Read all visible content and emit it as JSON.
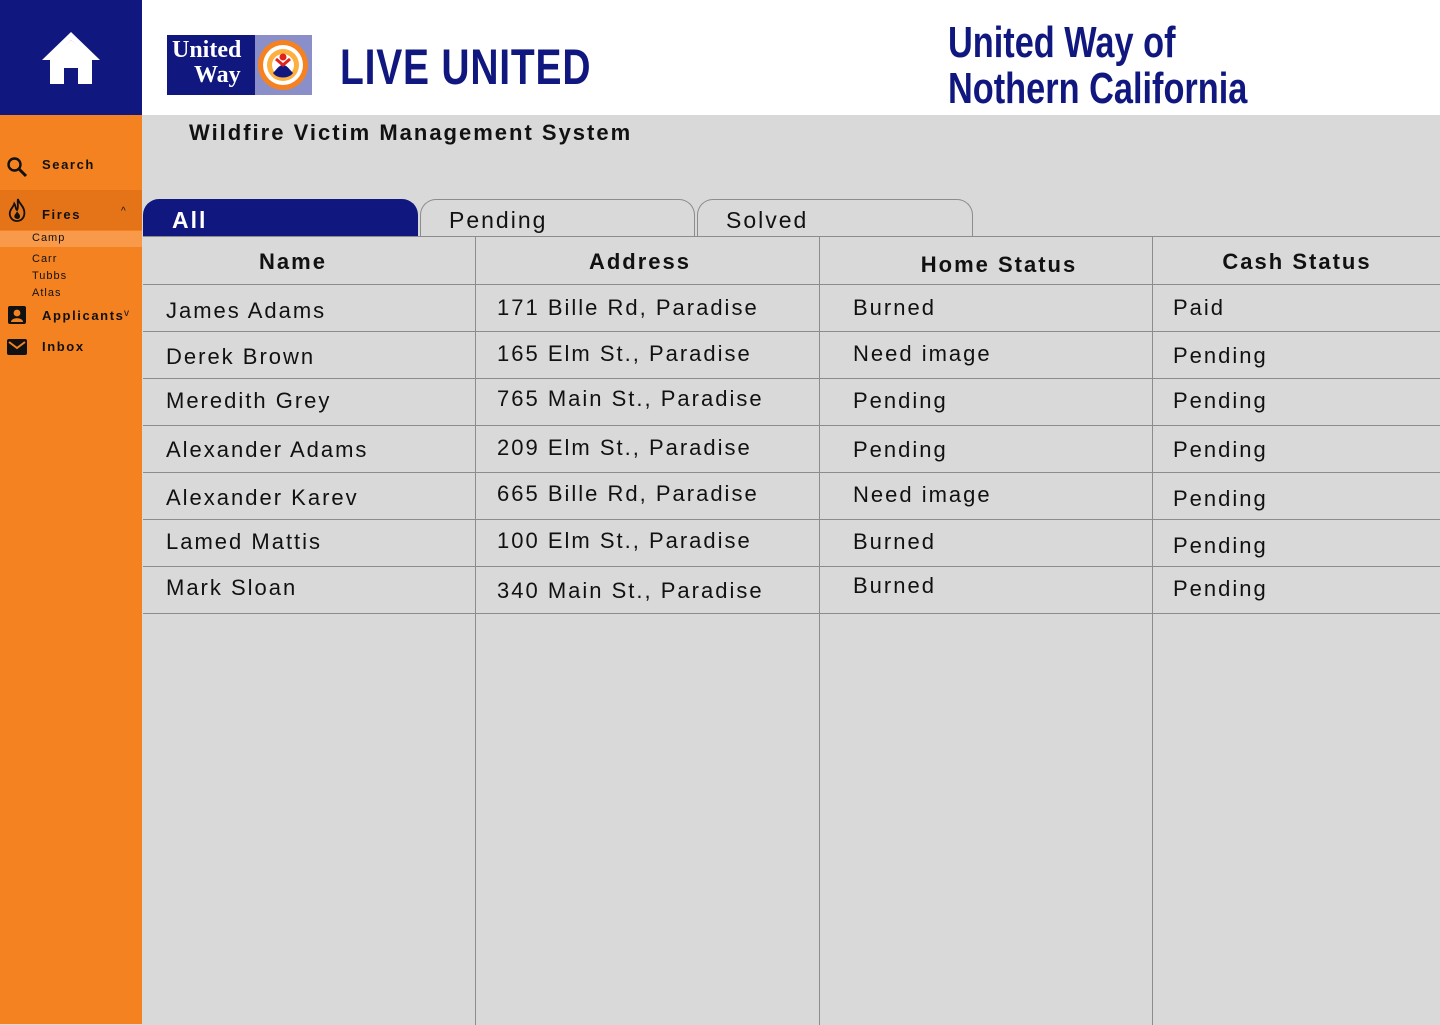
{
  "header": {
    "logo_text_line1": "United",
    "logo_text_line2": "Way",
    "tagline": "LIVE UNITED",
    "org_line1": "United Way of",
    "org_line2": "Nothern California"
  },
  "page_title": "Wildfire Victim Management System",
  "sidebar": {
    "search_label": "Search",
    "fires_label": "Fires",
    "fires": [
      "Camp",
      "Carr",
      "Tubbs",
      "Atlas"
    ],
    "applicants_label": "Applicants",
    "inbox_label": "Inbox"
  },
  "tabs": [
    "All",
    "Pending",
    "Solved"
  ],
  "table": {
    "columns": [
      "Name",
      "Address",
      "Home Status",
      "Cash Status"
    ],
    "rows": [
      [
        "James Adams",
        "171 Bille Rd, Paradise",
        "Burned",
        "Paid"
      ],
      [
        "Derek Brown",
        "165 Elm St., Paradise",
        "Need image",
        "Pending"
      ],
      [
        "Meredith Grey",
        "765 Main St., Paradise",
        "Pending",
        "Pending"
      ],
      [
        "Alexander Adams",
        "209 Elm St., Paradise",
        "Pending",
        "Pending"
      ],
      [
        "Alexander Karev",
        "665 Bille Rd, Paradise",
        "Need image",
        "Pending"
      ],
      [
        "Lamed Mattis",
        "100 Elm St., Paradise",
        "Burned",
        "Pending"
      ],
      [
        "Mark Sloan",
        "340 Main St., Paradise",
        "Burned",
        "Pending"
      ]
    ]
  },
  "colors": {
    "brand_navy": "#10187f",
    "brand_orange": "#f58220",
    "background": "#d9d9d9"
  },
  "icons": [
    "home-icon",
    "search-icon",
    "fire-icon",
    "person-icon",
    "mail-icon",
    "united-way-hand-icon"
  ]
}
